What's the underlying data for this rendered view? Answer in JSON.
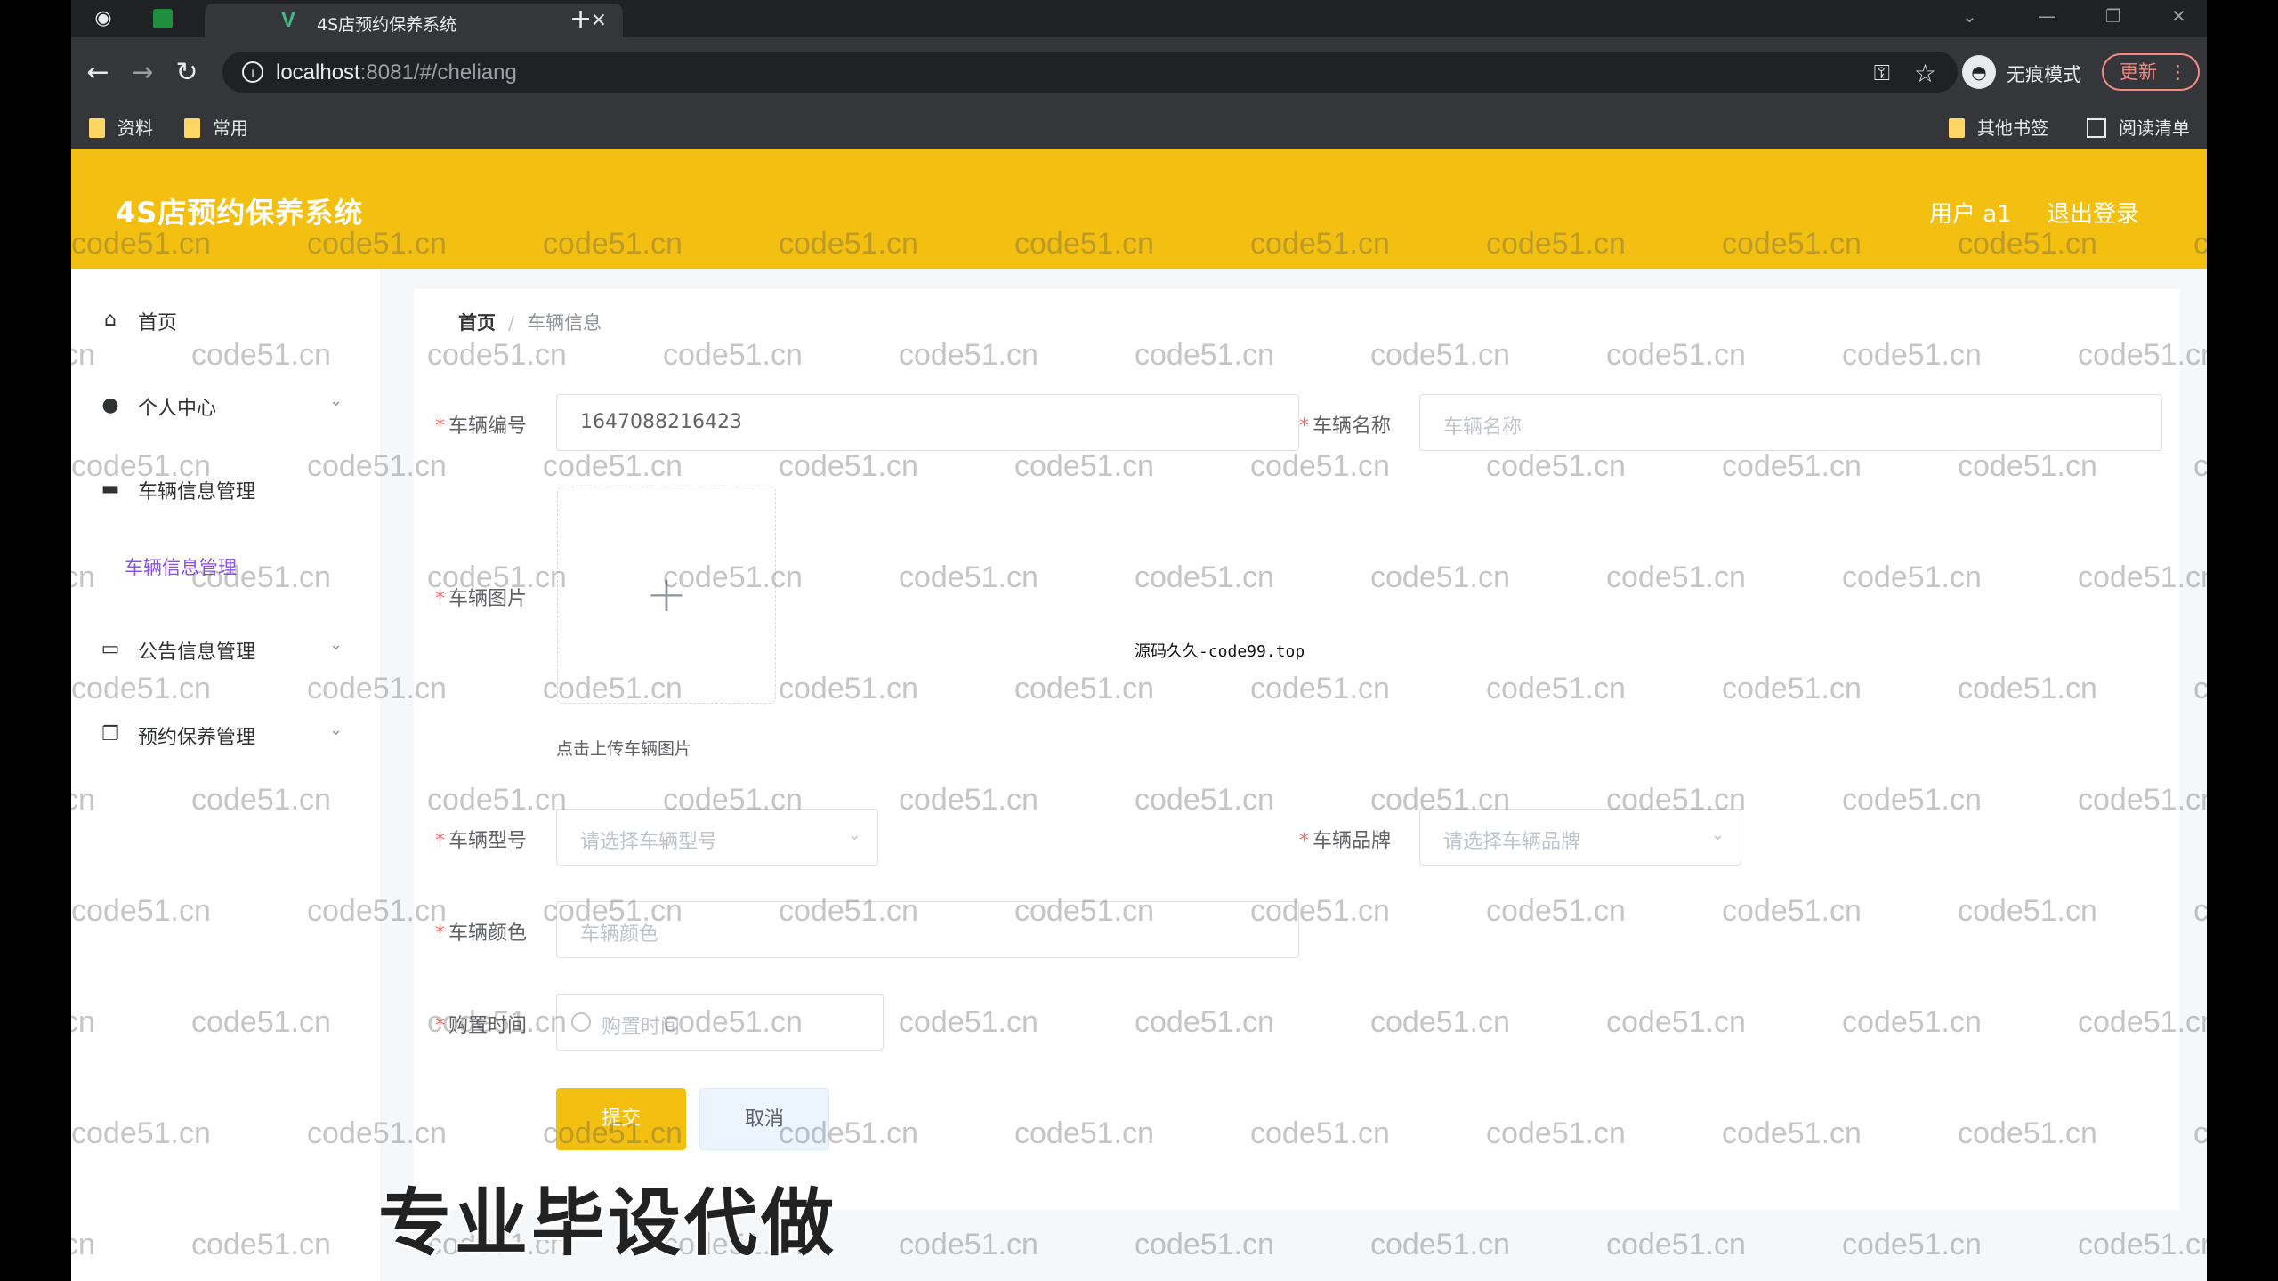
{
  "browser": {
    "tab_title": "4S店预约保养系统",
    "tab_close": "×",
    "new_tab": "+",
    "url_host": "localhost",
    "url_rest": ":8081/#/cheliang",
    "incognito_label": "无痕模式",
    "update_label": "更新",
    "bookmarks": [
      "资料",
      "常用"
    ],
    "bookmarks_right": [
      "其他书签",
      "阅读清单"
    ]
  },
  "header": {
    "app_title": "4S店预约保养系统",
    "user_label": "用户 a1",
    "logout_label": "退出登录",
    "accent_color": "#f3bf10"
  },
  "sidebar": {
    "items": [
      {
        "label": "首页",
        "icon": "home-icon"
      },
      {
        "label": "个人中心",
        "icon": "user-icon"
      },
      {
        "label": "车辆信息管理",
        "icon": "folder-icon"
      },
      {
        "label": "公告信息管理",
        "icon": "monitor-icon"
      },
      {
        "label": "预约保养管理",
        "icon": "copy-icon"
      }
    ],
    "active_subitem": "车辆信息管理"
  },
  "breadcrumb": {
    "home": "首页",
    "separator": "/",
    "current": "车辆信息"
  },
  "form": {
    "vehicle_number_label": "车辆编号",
    "vehicle_number_value": "1647088216423",
    "vehicle_name_label": "车辆名称",
    "vehicle_name_placeholder": "车辆名称",
    "vehicle_image_label": "车辆图片",
    "upload_tip": "点击上传车辆图片",
    "vehicle_model_label": "车辆型号",
    "vehicle_model_placeholder": "请选择车辆型号",
    "vehicle_brand_label": "车辆品牌",
    "vehicle_brand_placeholder": "请选择车辆品牌",
    "vehicle_color_label": "车辆颜色",
    "vehicle_color_placeholder": "车辆颜色",
    "purchase_time_label": "购置时间",
    "purchase_time_placeholder": "购置时间",
    "submit_label": "提交",
    "cancel_label": "取消"
  },
  "overlay": {
    "center_note": "源码久久-code99.top",
    "caption": "专业毕设代做",
    "watermark": "code51.cn"
  }
}
